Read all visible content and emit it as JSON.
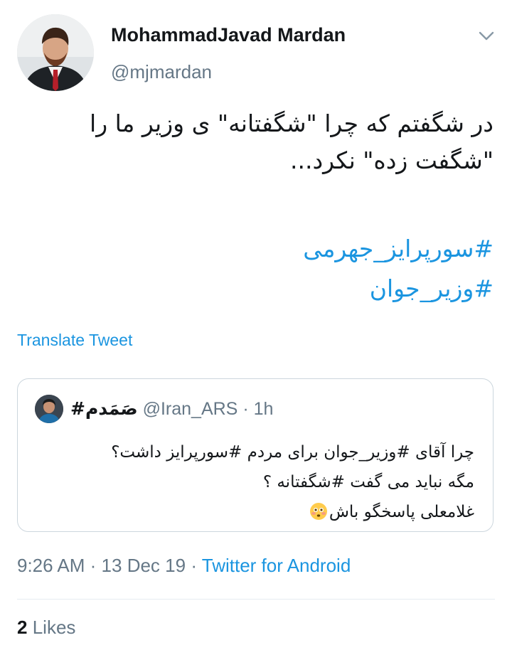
{
  "tweet": {
    "author": {
      "display_name": "MohammadJavad Mardan",
      "handle": "@mjmardan",
      "avatar_icon": "profile-photo-icon"
    },
    "text_lines": [
      "در شگفتم که چرا \"شگفتانه\" ی وزیر ما را",
      "\"شگفت زده\" نکرد..."
    ],
    "hashtags": [
      "#سورپرایز_جهرمی",
      "#وزیر_جوان"
    ],
    "translate_label": "Translate Tweet",
    "quoted": {
      "display_name": "#صَمَدم",
      "handle": "@Iran_ARS",
      "separator": "·",
      "time": "1h",
      "lines": [
        "چرا آقای #وزیر_جوان برای مردم #سورپرایز داشت؟",
        "مگه نباید می گفت #شگفتانه ؟",
        "غلامعلی پاسخگو باش"
      ],
      "emoji_icon": "flushed-face-emoji-icon"
    },
    "time": "9:26 AM",
    "separator": "·",
    "date": "13 Dec 19",
    "source": "Twitter for Android",
    "likes_count": "2",
    "likes_label": "Likes"
  },
  "colors": {
    "link": "#1b95e0",
    "secondary": "#657786",
    "primary_text": "#14171a",
    "border": "#ccd6dd"
  }
}
